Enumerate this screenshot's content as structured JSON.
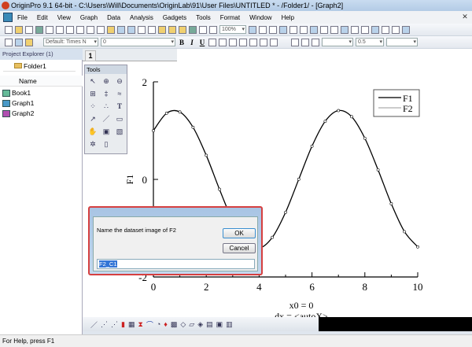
{
  "window": {
    "title": "OriginPro 9.1 64-bit - C:\\Users\\Will\\Documents\\OriginLab\\91\\User Files\\UNTITLED * - /Folder1/ - [Graph2]"
  },
  "menu": [
    "File",
    "Edit",
    "View",
    "Graph",
    "Data",
    "Analysis",
    "Gadgets",
    "Tools",
    "Format",
    "Window",
    "Help"
  ],
  "toolbar": {
    "zoom": "100%",
    "font": "Default: Times N",
    "font_size": "0",
    "line_width": "0.5",
    "bold": "B",
    "italic": "I",
    "underline": "U"
  },
  "project_explorer": {
    "title": "Project Explorer (1)",
    "folder": "Folder1",
    "column": "Name",
    "items": [
      "Book1",
      "Graph1",
      "Graph2"
    ]
  },
  "graph_tab": "1",
  "tools": {
    "title": "Tools"
  },
  "dialog": {
    "prompt": "Name the dataset image of F2",
    "ok": "OK",
    "cancel": "Cancel",
    "input_value": "F2_C1"
  },
  "status": "For Help, press F1",
  "chart_data": {
    "type": "line",
    "ylabel": "F1",
    "xlabel_lines": [
      "x0 = 0",
      "dx = <autoX>"
    ],
    "xlim": [
      0,
      10
    ],
    "ylim": [
      -2,
      2
    ],
    "xticks": [
      0,
      2,
      4,
      6,
      8,
      10
    ],
    "yticks": [
      -2,
      0,
      2
    ],
    "legend": [
      "F1",
      "F2"
    ],
    "legend_position": "top-right",
    "x": [
      0,
      0.5,
      1,
      1.5,
      2,
      2.5,
      3,
      3.5,
      4,
      4.5,
      5,
      5.5,
      6,
      6.5,
      7,
      7.5,
      8,
      8.5,
      9,
      9.5,
      10
    ],
    "series": [
      {
        "name": "F1",
        "values": [
          1.0,
          1.357,
          1.382,
          1.068,
          0.493,
          -0.203,
          -0.849,
          -1.287,
          -1.41,
          -1.188,
          -0.675,
          0.003,
          0.681,
          1.192,
          1.411,
          1.285,
          0.843,
          0.196,
          -0.499,
          -1.072,
          -1.383
        ]
      }
    ],
    "colors": {
      "line": "#000000"
    }
  }
}
